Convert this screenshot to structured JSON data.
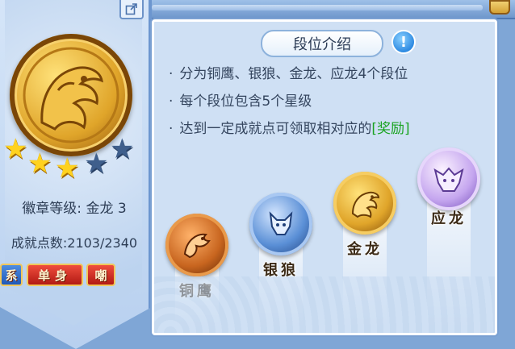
{
  "badge_panel": {
    "level_label": "徽章等级: 金龙 3",
    "points_label": "成就点数:2103/2340",
    "stars_total": 5,
    "stars_filled": 3,
    "tabs": [
      {
        "label": "系"
      },
      {
        "label": "单身"
      },
      {
        "label": "嘲"
      }
    ]
  },
  "intro": {
    "title": "段位介绍",
    "lines": [
      "分为铜鹰、银狼、金龙、应龙4个段位",
      "每个段位包含5个星级",
      "达到一定成就点可领取相对应的"
    ],
    "reward_link": "[奖励]"
  },
  "ranks": [
    {
      "name": "铜鹰",
      "medal_color": "#c8651f",
      "icon": "eagle-icon"
    },
    {
      "name": "银狼",
      "medal_color": "#5a8fd6",
      "icon": "wolf-icon"
    },
    {
      "name": "金龙",
      "medal_color": "#e0a52a",
      "icon": "dragon-icon"
    },
    {
      "name": "应龙",
      "medal_color": "#c5a6ef",
      "icon": "winged-dragon-icon"
    }
  ],
  "colors": {
    "reward_green": "#1aa321",
    "star_gold": "#ffd21f",
    "panel_blue": "#7fa6d6"
  }
}
